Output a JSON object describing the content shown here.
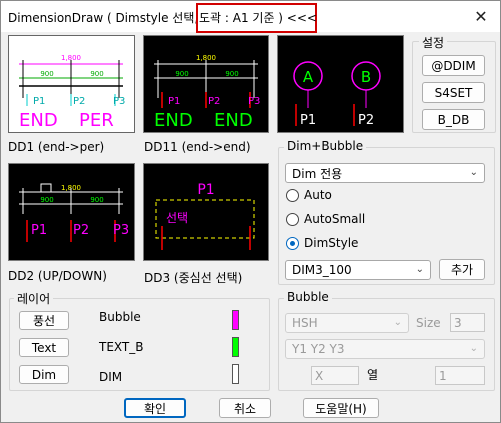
{
  "window": {
    "title_prefix": "DimensionDraw ( Dimstyle 선택,",
    "title_highlight": "도곽 : A1 기준 ) <<<",
    "close_glyph": "✕"
  },
  "previews": [
    {
      "caption": "DD1 (end->per)",
      "selected": true
    },
    {
      "caption": "DD11 (end->end)",
      "selected": false
    },
    {
      "caption": "",
      "selected": false
    },
    {
      "caption": "DD2 (UP/DOWN)",
      "selected": false
    },
    {
      "caption": "DD3 (중심선 선택)",
      "selected": false
    }
  ],
  "preview_text": {
    "dim_total": "1,800",
    "dim_part": "900",
    "p1": "P1",
    "p2": "P2",
    "p3": "P3",
    "end": "END",
    "per": "PER",
    "bubble_a": "A",
    "bubble_b": "B",
    "select": "선택"
  },
  "settings": {
    "legend": "설정",
    "buttons": [
      "@DDIM",
      "S4SET",
      "B_DB"
    ]
  },
  "dim_bubble": {
    "legend": "Dim+Bubble",
    "mode_value": "Dim 전용",
    "radios": [
      {
        "label": "Auto",
        "checked": false
      },
      {
        "label": "AutoSmall",
        "checked": false
      },
      {
        "label": "DimStyle",
        "checked": true
      }
    ],
    "style_value": "DIM3_100",
    "add_label": "추가"
  },
  "layer": {
    "legend": "레이어",
    "rows": [
      {
        "button": "풍선",
        "name": "Bubble",
        "color": "#ff00ff"
      },
      {
        "button": "Text",
        "name": "TEXT_B",
        "color": "#00ff00"
      },
      {
        "button": "Dim",
        "name": "DIM",
        "color": "#ffffff"
      }
    ]
  },
  "bubble": {
    "legend": "Bubble",
    "type_value": "HSH",
    "size_label": "Size",
    "size_value": "3",
    "labels_value": "Y1 Y2 Y3",
    "x_value": "X",
    "col_label": "열",
    "col_value": "1"
  },
  "footer": {
    "ok": "확인",
    "cancel": "취소",
    "help": "도움말(H)"
  },
  "colors": {
    "accent": "#0067c0",
    "highlight_border": "#d10000",
    "cad_magenta": "#ff00ff",
    "cad_green": "#00ff00",
    "cad_cyan": "#00ffff",
    "cad_yellow": "#ffff00",
    "cad_red": "#ff0000"
  }
}
